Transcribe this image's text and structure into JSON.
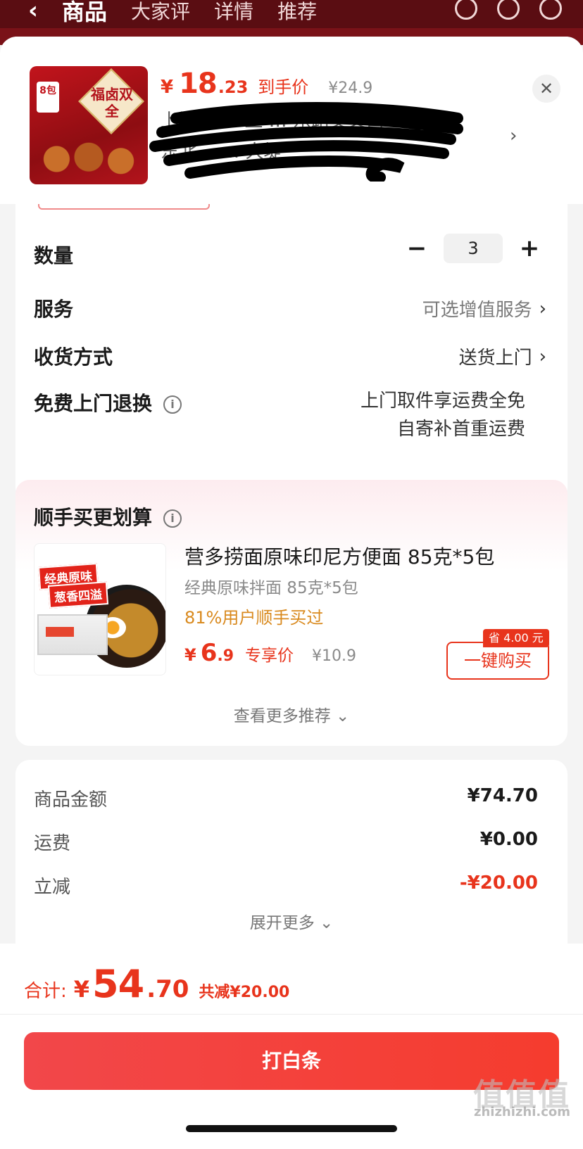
{
  "topbar": {
    "back_icon": "‹",
    "tabs": [
      "商品",
      "大家评",
      "详情",
      "推荐"
    ]
  },
  "product": {
    "price_yen": "¥",
    "price_int": "18",
    "price_dec": ".23",
    "price_label": "到手价",
    "original_price": "¥24.9",
    "address_line1": "上海 …08上 … 东路交叉口",
    "address_line2": "东北 …… 大堤",
    "thumb_badge": "8包",
    "thumb_title": "福卤双全"
  },
  "options": {
    "quantity_label": "数量",
    "quantity_value": "3",
    "minus": "−",
    "plus": "+",
    "service_label": "服务",
    "service_value": "可选增值服务",
    "delivery_label": "收货方式",
    "delivery_value": "送货上门",
    "return_label": "免费上门退换",
    "return_line1": "上门取件享运费全免",
    "return_line2": "自寄补首重运费"
  },
  "recommend": {
    "title": "顺手买更划算",
    "name": "营多捞面原味印尼方便面 85克*5包",
    "sub": "经典原味拌面 85克*5包",
    "social": "81%用户顺手买过",
    "price_yen": "¥",
    "price_int": "6",
    "price_dec": ".9",
    "price_label": "专享价",
    "original_price": "¥10.9",
    "save_badge": "省 4.00 元",
    "buy_label": "一键购买",
    "img_tag1": "经典原味",
    "img_tag2": "葱香四溢",
    "more": "查看更多推荐 ⌄"
  },
  "summary": {
    "rows": [
      {
        "key": "商品金额",
        "value": "¥74.70"
      },
      {
        "key": "运费",
        "value": "¥0.00"
      },
      {
        "key": "立减",
        "value": "-¥20.00"
      }
    ],
    "expand": "展开更多 ⌄"
  },
  "footer": {
    "total_label": "合计:",
    "total_yen": "¥",
    "total_int": "54",
    "total_dec": ".70",
    "reduce": "共减¥20.00",
    "pay_label": "打白条"
  },
  "watermark": {
    "big": "值值值",
    "url": "zhizhizhi.com"
  },
  "colors": {
    "accent_red": "#e8341c",
    "header_dark_red": "#5a0d12",
    "social_orange": "#d98a1f"
  }
}
